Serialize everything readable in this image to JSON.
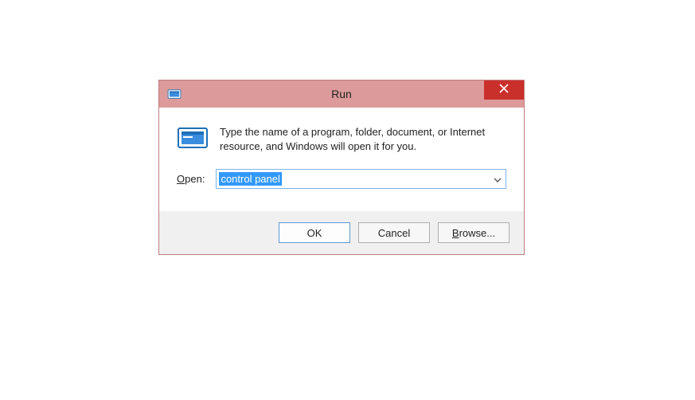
{
  "window": {
    "title": "Run",
    "close_accessible": "Close"
  },
  "body": {
    "description": "Type the name of a program, folder, document, or Internet resource, and Windows will open it for you.",
    "open_label_prefix": "O",
    "open_label_rest": "pen:",
    "input_value": "control panel"
  },
  "buttons": {
    "ok": "OK",
    "cancel": "Cancel",
    "browse_prefix": "B",
    "browse_rest": "rowse..."
  },
  "icons": {
    "titlebar": "run-program-icon",
    "run": "run-program-icon",
    "dropdown": "chevron-down-icon",
    "close": "close-icon"
  },
  "colors": {
    "titlebar_bg": "#dc9a9a",
    "close_bg": "#c9302c",
    "combo_border": "#7eb4ea",
    "selection_bg": "#3399ff"
  }
}
